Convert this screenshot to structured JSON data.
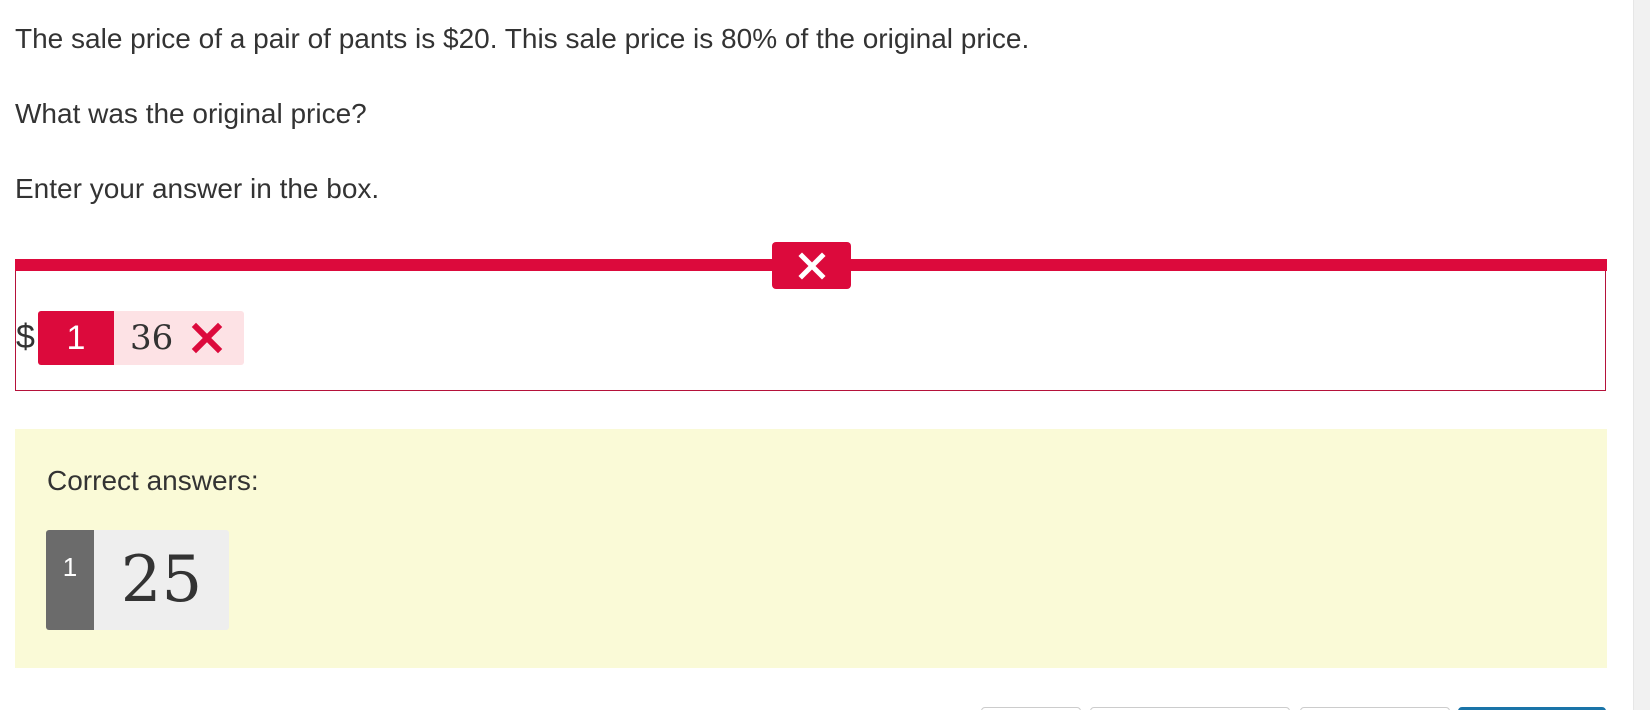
{
  "question": {
    "line1": "The sale price of a pair of pants is $20. This sale price is 80% of the original price.",
    "line2": "What was the original price?",
    "line3": "Enter your answer in the box."
  },
  "response": {
    "status_icon": "close-icon",
    "status": "incorrect",
    "currency_symbol": "$",
    "response_index": "1",
    "entered_value": "36",
    "result_icon": "close-icon"
  },
  "correct_answers": {
    "title": "Correct answers:",
    "items": [
      {
        "index": "1",
        "value": "25"
      }
    ]
  },
  "colors": {
    "incorrect": "#dc0a3c",
    "incorrect_light": "#fde2e5",
    "correct_panel_bg": "#fafad7",
    "correct_index_bg": "#6b6b6b",
    "primary_button": "#1a74a8"
  }
}
